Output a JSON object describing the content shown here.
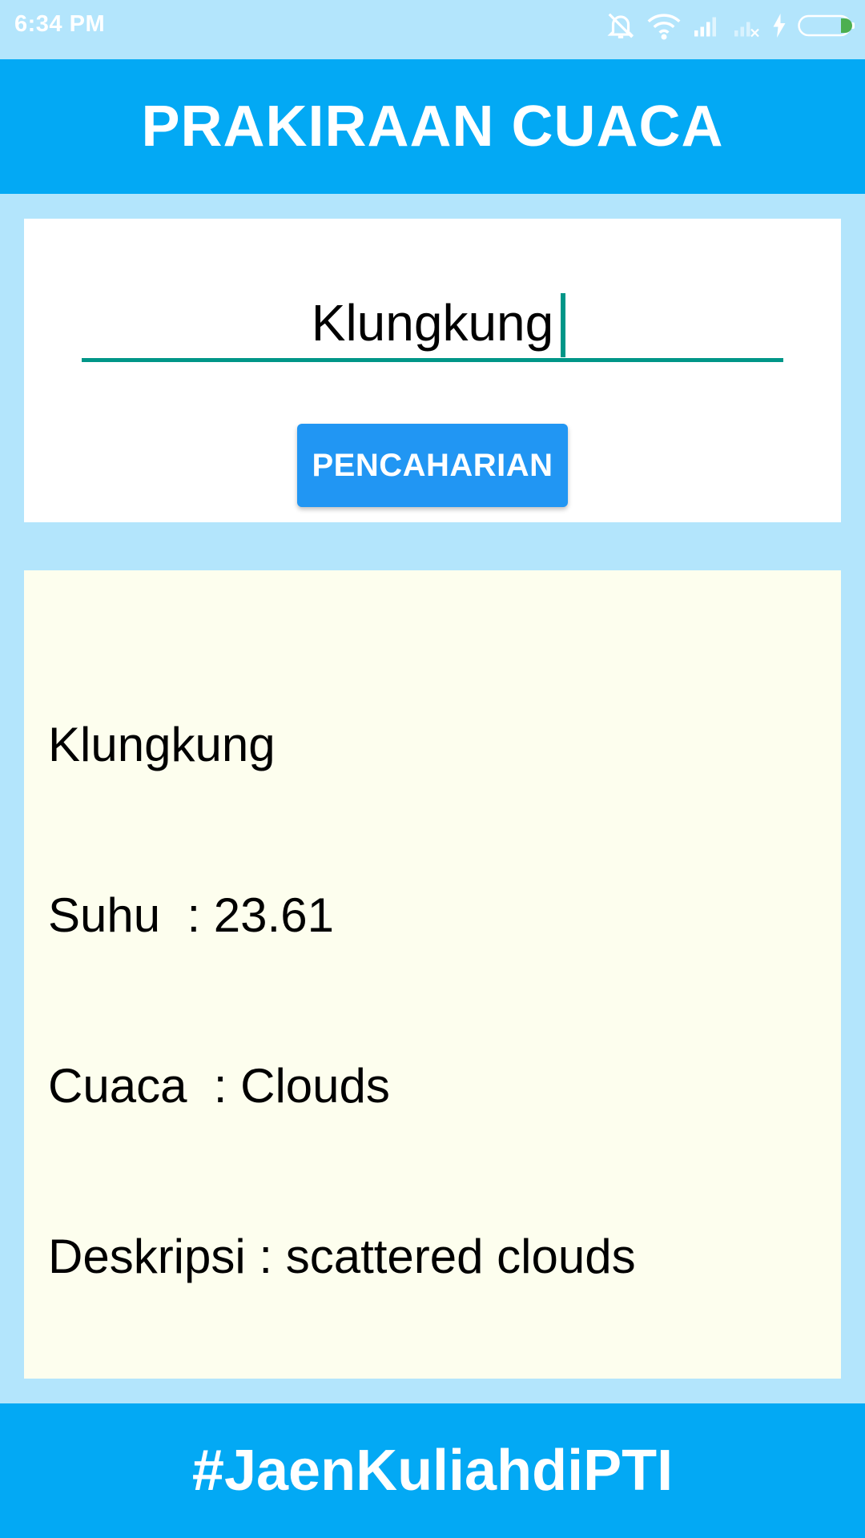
{
  "status_bar": {
    "time": "6:34 PM",
    "icons": [
      "muted-bell-icon",
      "wifi-icon",
      "signal-icon",
      "no-signal-icon",
      "charging-icon",
      "battery-icon"
    ]
  },
  "header": {
    "title": "PRAKIRAAN CUACA"
  },
  "search": {
    "input_value": "Klungkung",
    "button_label": "PENCAHARIAN"
  },
  "result": {
    "lines": [
      "Klungkung",
      "Suhu  : 23.61",
      "Cuaca  : Clouds",
      "Deskripsi : scattered clouds"
    ]
  },
  "footer": {
    "text": "#JaenKuliahdiPTI"
  },
  "colors": {
    "background": "#b3e5fc",
    "header": "#03a9f4",
    "button": "#2196f3",
    "input_underline": "#009688",
    "result_background": "#fdfeee"
  }
}
